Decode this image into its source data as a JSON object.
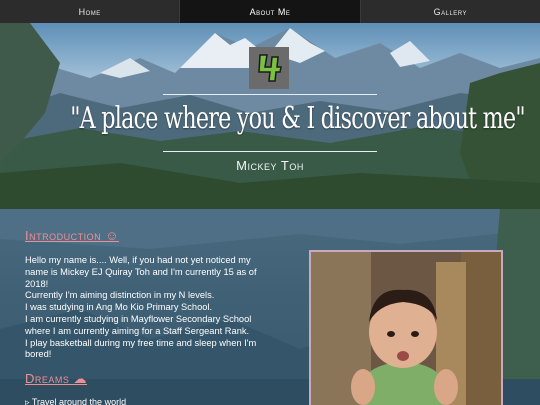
{
  "nav": {
    "items": [
      {
        "label": "Home",
        "active": false
      },
      {
        "label": "About Me",
        "active": true
      },
      {
        "label": "Gallery",
        "active": false
      }
    ]
  },
  "hero": {
    "logo_icon": "green-four-logo-icon",
    "quote": "\"A place where you & I discover about me\"",
    "author": "Mickey Toh"
  },
  "intro": {
    "heading": "Introduction ☺",
    "lines": [
      "Hello my name is.... Well, if you had not yet noticed my name is Mickey EJ Quiray Toh and I'm currently 15 as of 2018!",
      "Currently I'm aiming distinction in my N levels.",
      "I was studying in Ang Mo Kio Primary School.",
      "I am currently studying in Mayflower Secondary School where I am currently aiming for a Staff Sergeant Rank.",
      "I play basketball during my free time and sleep when I'm bored!"
    ]
  },
  "dreams": {
    "heading": "Dreams ☁",
    "items": [
      "▹ Travel around the world"
    ]
  },
  "photo": {
    "icon": "baby-photo-image"
  },
  "colors": {
    "accent": "#ef8f95",
    "nav_bg": "#2c2c2c",
    "nav_active": "#141414"
  }
}
